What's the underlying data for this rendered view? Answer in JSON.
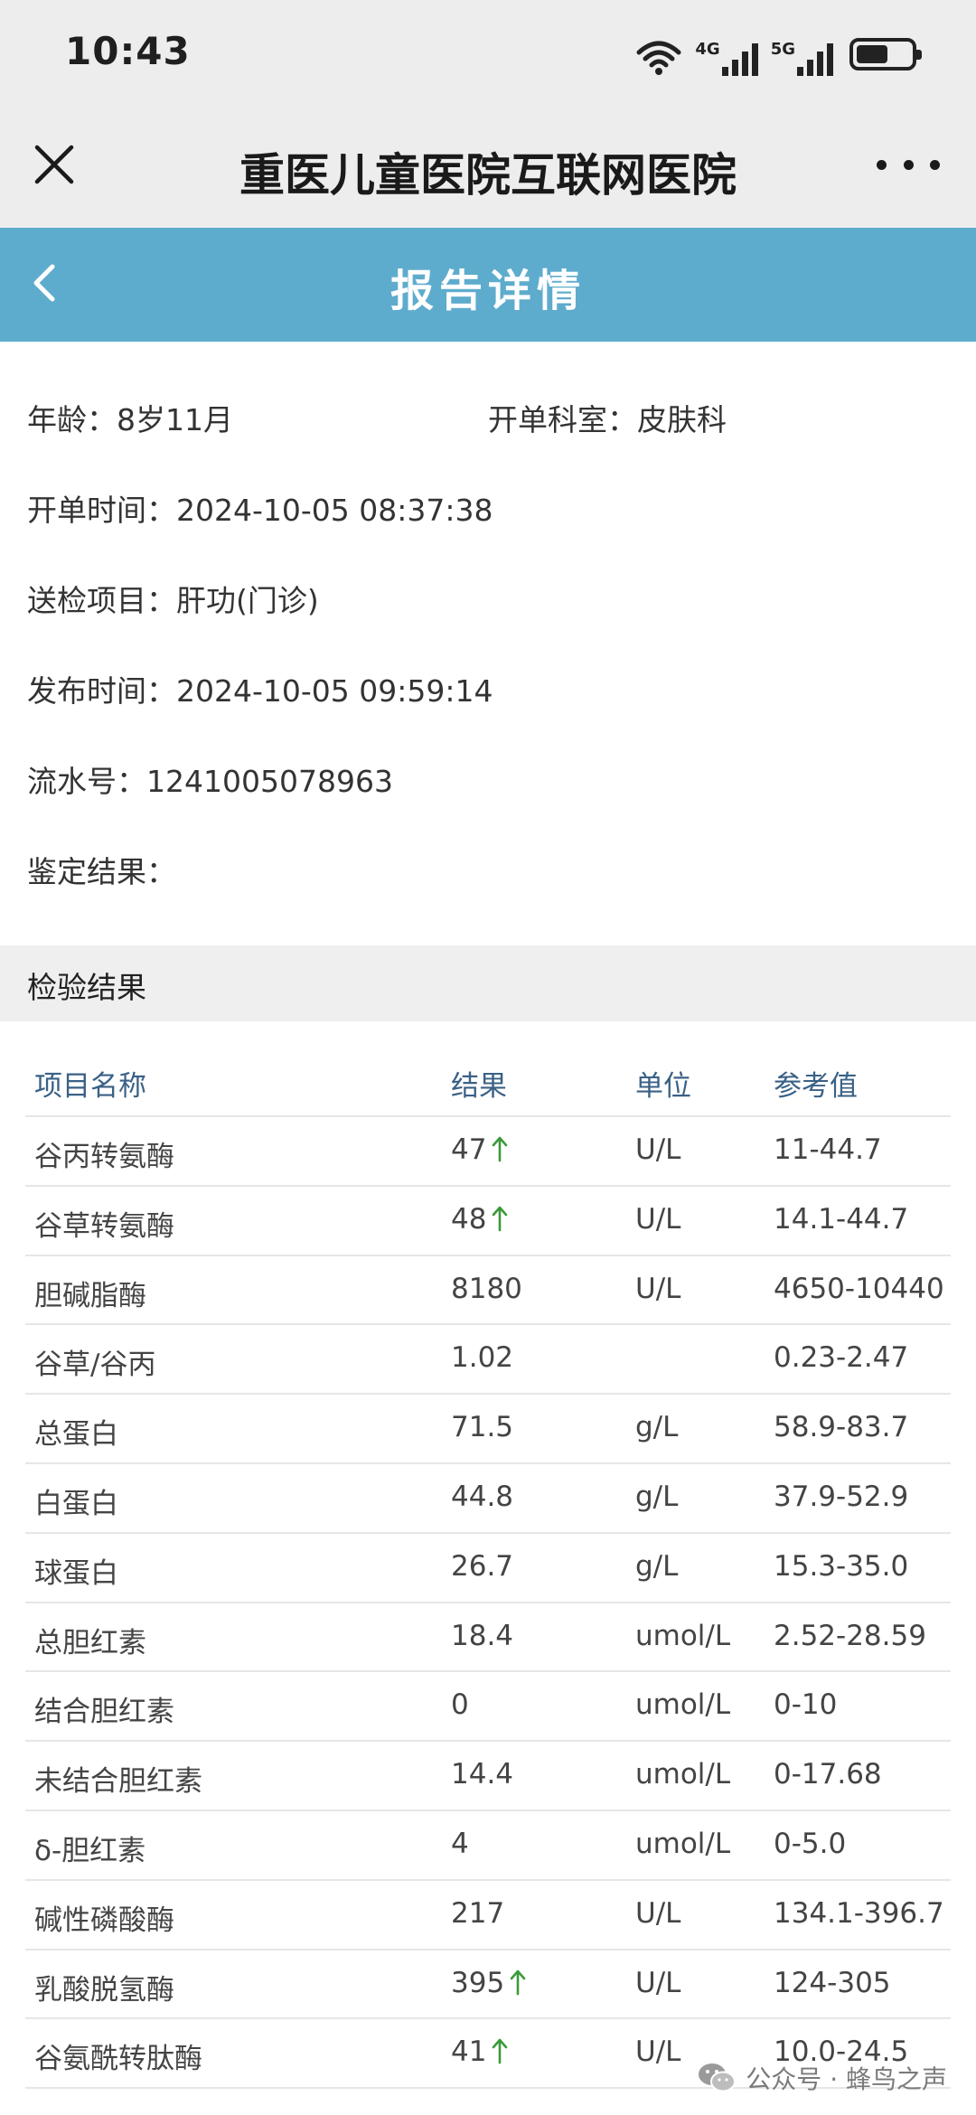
{
  "status_bar": {
    "time": "10:43",
    "net1": "4G",
    "net2": "5G",
    "icons": [
      "wifi-icon",
      "signal-4g-icon",
      "signal-5g-icon",
      "battery-icon"
    ]
  },
  "title_bar": {
    "title": "重医儿童医院互联网医院",
    "close_icon": "close-icon",
    "more_icon": "more-icon"
  },
  "header": {
    "title": "报告详情",
    "back_icon": "chevron-left-icon",
    "color": "#5eaccd"
  },
  "info": {
    "age_label": "年龄：",
    "age_value": "8岁11月",
    "dept_label": "开单科室：",
    "dept_value": "皮肤科",
    "order_time_label": "开单时间：",
    "order_time_value": "2024-10-05 08:37:38",
    "item_label": "送检项目：",
    "item_value": "肝功(门诊)",
    "publish_time_label": "发布时间：",
    "publish_time_value": "2024-10-05 09:59:14",
    "serial_label": "流水号：",
    "serial_value": "1241005078963",
    "conclusion_label": "鉴定结果："
  },
  "results": {
    "section_title": "检验结果",
    "columns": [
      "项目名称",
      "结果",
      "单位",
      "参考值"
    ],
    "up_arrow_color": "#3a9a3a",
    "rows": [
      {
        "name": "谷丙转氨酶",
        "result": "47",
        "unit": "U/L",
        "ref": "11-44.7",
        "high": true
      },
      {
        "name": "谷草转氨酶",
        "result": "48",
        "unit": "U/L",
        "ref": "14.1-44.7",
        "high": true
      },
      {
        "name": "胆碱脂酶",
        "result": "8180",
        "unit": "U/L",
        "ref": "4650-10440",
        "high": false
      },
      {
        "name": "谷草/谷丙",
        "result": "1.02",
        "unit": "",
        "ref": "0.23-2.47",
        "high": false
      },
      {
        "name": "总蛋白",
        "result": "71.5",
        "unit": "g/L",
        "ref": "58.9-83.7",
        "high": false
      },
      {
        "name": "白蛋白",
        "result": "44.8",
        "unit": "g/L",
        "ref": "37.9-52.9",
        "high": false
      },
      {
        "name": "球蛋白",
        "result": "26.7",
        "unit": "g/L",
        "ref": "15.3-35.0",
        "high": false
      },
      {
        "name": "总胆红素",
        "result": "18.4",
        "unit": "umol/L",
        "ref": "2.52-28.59",
        "high": false
      },
      {
        "name": "结合胆红素",
        "result": "0",
        "unit": "umol/L",
        "ref": "0-10",
        "high": false
      },
      {
        "name": "未结合胆红素",
        "result": "14.4",
        "unit": "umol/L",
        "ref": "0-17.68",
        "high": false
      },
      {
        "name": "δ-胆红素",
        "result": "4",
        "unit": "umol/L",
        "ref": "0-5.0",
        "high": false
      },
      {
        "name": "碱性磷酸酶",
        "result": "217",
        "unit": "U/L",
        "ref": "134.1-396.7",
        "high": false
      },
      {
        "name": "乳酸脱氢酶",
        "result": "395",
        "unit": "U/L",
        "ref": "124-305",
        "high": true
      },
      {
        "name": "谷氨酰转肽酶",
        "result": "41",
        "unit": "U/L",
        "ref": "10.0-24.5",
        "high": true
      }
    ]
  },
  "watermark": {
    "text": "公众号 · 蜂鸟之声",
    "icon": "wechat-icon"
  }
}
